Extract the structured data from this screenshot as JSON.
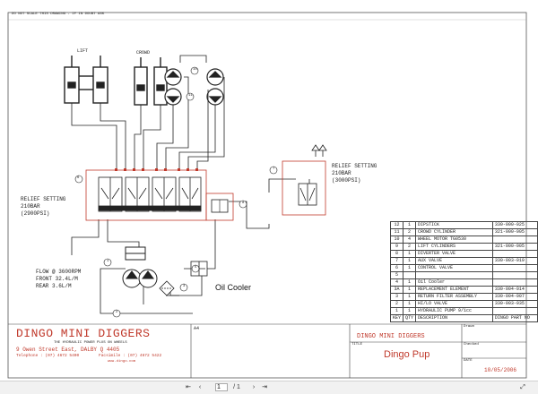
{
  "header_note": "DO NOT SCALE THIS DRAWING - IF IN DOUBT ASK",
  "labels": {
    "lift": "LIFT",
    "crowd": "CROWD",
    "relief_left_1": "RELIEF SETTING",
    "relief_left_2": "210BAR",
    "relief_left_3": "(2900PSI)",
    "relief_right_1": "RELIEF SETTING",
    "relief_right_2": "210BAR",
    "relief_right_3": "(3000PSI)",
    "flow_1": "FLOW @ 3600RPM",
    "flow_2": "FRONT 32.4L/M",
    "flow_3": "REAR 3.6L/M",
    "oil_cooler": "Oil Cooler"
  },
  "callouts": [
    "10",
    "11",
    "10",
    "11",
    "8",
    "7",
    "9",
    "6",
    "5",
    "1",
    "2",
    "3"
  ],
  "parts_list": {
    "rows": [
      {
        "key": "12",
        "qty": "1",
        "desc": "DIPSTICK",
        "part": "330-000-025"
      },
      {
        "key": "11",
        "qty": "2",
        "desc": "CROWD CYLINDER",
        "part": "321-000-005"
      },
      {
        "key": "10",
        "qty": "4",
        "desc": "WHEEL MOTOR TG0530",
        "part": ""
      },
      {
        "key": "9",
        "qty": "2",
        "desc": "LIFT CYLINDERS",
        "part": "321-000-005"
      },
      {
        "key": "8",
        "qty": "1",
        "desc": "DIVERTER VALVE",
        "part": ""
      },
      {
        "key": "7",
        "qty": "1",
        "desc": "AUX VALVE",
        "part": "330-003-019"
      },
      {
        "key": "6",
        "qty": "1",
        "desc": "CONTROL VALVE",
        "part": ""
      },
      {
        "key": "5",
        "qty": "",
        "desc": "",
        "part": ""
      },
      {
        "key": "4",
        "qty": "1",
        "desc": "Oil Cooler",
        "part": ""
      },
      {
        "key": "3A",
        "qty": "1",
        "desc": "REPLACEMENT ELEMENT",
        "part": "330-004-014"
      },
      {
        "key": "3",
        "qty": "1",
        "desc": "RETURN FILTER ASSEMBLY",
        "part": "330-004-007"
      },
      {
        "key": "2",
        "qty": "1",
        "desc": "HI/LO VALVE",
        "part": "330-003-035"
      },
      {
        "key": "1",
        "qty": "1",
        "desc": "HYDRAULIC PUMP 9/1cc",
        "part": ""
      }
    ],
    "header": {
      "key": "KEY",
      "qty": "QTY",
      "desc": "DESCRIPTION",
      "part": "DINGO PART NO"
    }
  },
  "title_block": {
    "company": "DINGO MINI DIGGERS",
    "tagline": "THE HYDRAULIC POWER PLUS ON WHEELS",
    "address": "9 Owen Street East, DALBY Q 4405",
    "telephone": "Telephone : (07) 4672 5400",
    "facsimile": "Facsimile : (07) 4672 5422",
    "website": "www.dingo.com",
    "sheet_size": "A4",
    "company_right": "DINGO MINI DIGGERS",
    "title_label": "TITLE",
    "title": "Dingo Pup",
    "date_label": "DATE",
    "date": "10/05/2006",
    "drawn_label": "Drawn",
    "checked_label": "Checked"
  },
  "viewer": {
    "page_current": "1",
    "page_total": "/ 1",
    "icons": [
      "first-page-icon",
      "prev-page-icon",
      "next-page-icon",
      "last-page-icon",
      "zoom-icon"
    ]
  },
  "colors": {
    "red": "#c0392b",
    "line": "#222222"
  }
}
